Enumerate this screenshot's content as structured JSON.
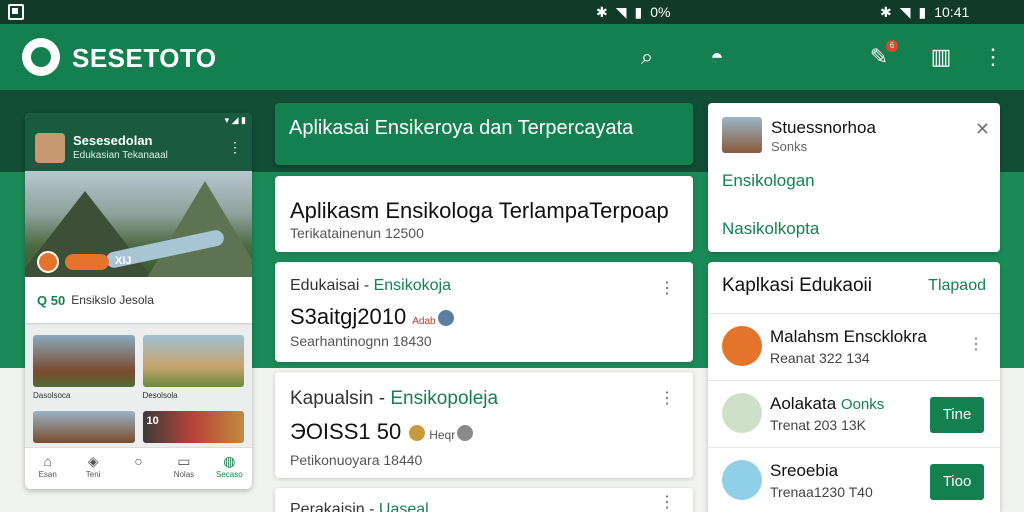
{
  "status_bar": {
    "left_text": "",
    "mid_text": "0%",
    "right_text": "10:41"
  },
  "app_bar": {
    "title": "SESETOTO",
    "notification_count": "6"
  },
  "phone": {
    "title": "Sesesedolan",
    "subtitle": "Edukasian Tekanaaal",
    "hero_label": "XIJ",
    "search_prefix": "Q  50",
    "search_text": "Ensikslo Jesola",
    "tiles": [
      {
        "caption": "Dasolsoca"
      },
      {
        "caption": "Desolsola"
      }
    ],
    "tile2_label": "10",
    "nav": [
      {
        "label": "Esan"
      },
      {
        "label": "Teni"
      },
      {
        "label": ""
      },
      {
        "label": "Nolas"
      },
      {
        "label": "Secaso"
      }
    ]
  },
  "banner": {
    "text": "Aplikasai Ensikeroya dan Terpercayata"
  },
  "cards": [
    {
      "title": "Aplikasm Ensikologa TerlampaTerpoap",
      "subtitle": "Terikatainenun 12500"
    },
    {
      "kicker": "Edukaisai - ",
      "kicker_green": "Ensikokoja",
      "number": "S3aitgj2010",
      "tag": "Adab",
      "subtitle": "Searhantinognn 18430"
    },
    {
      "kicker": "Kapualsin - ",
      "kicker_green": "Ensikopoleja",
      "number": "ЭOISS1 50",
      "tag": "Heqr",
      "subtitle": "Petikonuoyara 18440"
    },
    {
      "kicker": "Perakaisin - ",
      "kicker_green": "Uaseal"
    }
  ],
  "right_top": {
    "title": "Stuessnorhoa",
    "subtitle": "Sonks",
    "links": [
      "Ensikologan",
      "Nasikolkopta"
    ]
  },
  "right_list": {
    "header": "Kaplkasi Edukaoii",
    "header_action": "Tlapaod",
    "items": [
      {
        "name": "Malahsm Enscklokra",
        "sub": "Reanat 322 134",
        "action": ""
      },
      {
        "name": "Aolakata",
        "name_green": "Oonks",
        "sub": "Trenat 203 13K",
        "action": "Tine"
      },
      {
        "name": "Sreoebia",
        "sub": "Trenaa1230 T40",
        "action": "Tioo"
      }
    ]
  },
  "colors": {
    "brand": "#15804f",
    "dark": "#124d36",
    "accent": "#e4742b"
  }
}
